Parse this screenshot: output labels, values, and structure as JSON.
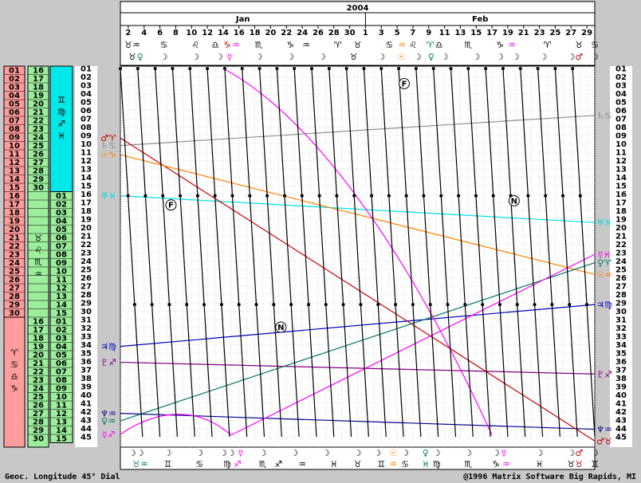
{
  "chart_data": {
    "type": "line",
    "title": "2004",
    "months": [
      {
        "name": "Jan",
        "start_day": 1,
        "end_day": 31
      },
      {
        "name": "Feb",
        "start_day": 32,
        "end_day": 60
      }
    ],
    "xlim": [
      1,
      61
    ],
    "ylim": [
      1,
      45
    ],
    "x_ticks": [
      {
        "day": 2,
        "label": "2"
      },
      {
        "day": 4,
        "label": "4"
      },
      {
        "day": 6,
        "label": "6"
      },
      {
        "day": 8,
        "label": "8"
      },
      {
        "day": 10,
        "label": "10"
      },
      {
        "day": 12,
        "label": "12"
      },
      {
        "day": 14,
        "label": "14"
      },
      {
        "day": 16,
        "label": "16"
      },
      {
        "day": 18,
        "label": "18"
      },
      {
        "day": 20,
        "label": "20"
      },
      {
        "day": 22,
        "label": "22"
      },
      {
        "day": 24,
        "label": "24"
      },
      {
        "day": 26,
        "label": "26"
      },
      {
        "day": 28,
        "label": "28"
      },
      {
        "day": 30,
        "label": "30"
      },
      {
        "day": 32,
        "label": "1"
      },
      {
        "day": 34,
        "label": "3"
      },
      {
        "day": 36,
        "label": "5"
      },
      {
        "day": 38,
        "label": "7"
      },
      {
        "day": 40,
        "label": "9"
      },
      {
        "day": 42,
        "label": "11"
      },
      {
        "day": 44,
        "label": "13"
      },
      {
        "day": 46,
        "label": "15"
      },
      {
        "day": 48,
        "label": "17"
      },
      {
        "day": 50,
        "label": "19"
      },
      {
        "day": 52,
        "label": "21"
      },
      {
        "day": 54,
        "label": "23"
      },
      {
        "day": 56,
        "label": "25"
      },
      {
        "day": 58,
        "label": "27"
      },
      {
        "day": 60,
        "label": "29"
      }
    ],
    "y_ticks": [
      "01",
      "02",
      "03",
      "04",
      "05",
      "06",
      "07",
      "08",
      "09",
      "10",
      "11",
      "12",
      "13",
      "14",
      "15",
      "16",
      "17",
      "18",
      "19",
      "20",
      "21",
      "22",
      "23",
      "24",
      "25",
      "26",
      "27",
      "28",
      "29",
      "30",
      "31",
      "32",
      "33",
      "34",
      "35",
      "36",
      "37",
      "38",
      "39",
      "40",
      "41",
      "42",
      "43",
      "44",
      "45"
    ],
    "sign_columns": [
      {
        "color": "#ff9c9c",
        "cells": [
          "01",
          "02",
          "03",
          "04",
          "05",
          "06",
          "07",
          "08",
          "09",
          "10",
          "11",
          "12",
          "13",
          "14",
          "15",
          "16",
          "17",
          "18",
          "19",
          "20",
          "21",
          "22",
          "23",
          "24",
          "25",
          "26",
          "27",
          "28",
          "29",
          "30"
        ],
        "bar_symbols": []
      },
      {
        "color": "#9cee9c",
        "cells": [
          "16",
          "17",
          "18",
          "19",
          "20",
          "21",
          "22",
          "23",
          "24",
          "25",
          "26",
          "27",
          "28",
          "29",
          "30",
          "01",
          "02",
          "03",
          "04",
          "05",
          "06",
          "07",
          "08",
          "09",
          "10",
          "11",
          "12",
          "13",
          "14",
          "15"
        ],
        "bar_symbols": []
      },
      {
        "color": "#00e8e8",
        "cells": [
          "01",
          "02",
          "03",
          "04",
          "05",
          "06",
          "07",
          "08",
          "09",
          "10",
          "11",
          "12",
          "13",
          "14",
          "15"
        ],
        "bar_symbols": [
          "♊",
          "♍",
          "♐",
          "♓"
        ]
      },
      {
        "color": "#9cee9c",
        "cells": [
          "01",
          "02",
          "03",
          "04",
          "05",
          "06",
          "07",
          "08",
          "09",
          "10",
          "11",
          "12",
          "13",
          "14",
          "15"
        ],
        "bar_symbols": []
      },
      {
        "color": "#9cee9c",
        "cells": [
          "01",
          "02",
          "03",
          "04",
          "05",
          "06",
          "07",
          "08",
          "09",
          "10",
          "11",
          "12",
          "13",
          "14",
          "15"
        ],
        "bar_symbols": []
      }
    ],
    "bar_symbol_sets": [
      {
        "symbols": [
          "♉",
          "♌",
          "♏",
          "♒"
        ],
        "color": "#9cee9c"
      },
      {
        "symbols": [
          "♈",
          "♋",
          "♎",
          "♑"
        ],
        "color": "#ff9c9c"
      }
    ],
    "planet_lines": [
      {
        "glyph": "♄♋",
        "color": "#909090",
        "start": [
          1,
          10.2
        ],
        "end": [
          61,
          6.6
        ],
        "label_left": "♄♋",
        "label_right": "♄♋"
      },
      {
        "glyph": "♅♓",
        "color": "#00e0e0",
        "start": [
          1,
          16.2
        ],
        "end": [
          61,
          19.4
        ],
        "label_left": "♅♓",
        "label_right": "♅♓"
      },
      {
        "glyph": "♃♍",
        "color": "#0000c0",
        "start": [
          1,
          34.2
        ],
        "end": [
          61,
          29.2
        ],
        "label_left": "♃♍",
        "label_right": "♃♍"
      },
      {
        "glyph": "♇♐",
        "color": "#800080",
        "start": [
          1,
          36.1
        ],
        "end": [
          61,
          37.5
        ],
        "label_left": "♇♐",
        "label_right": "♇♐"
      },
      {
        "glyph": "♆♒",
        "color": "#000090",
        "start": [
          1,
          42.2
        ],
        "end": [
          61,
          44.1
        ],
        "label_left": "♆♒",
        "label_right": "♆♒"
      },
      {
        "glyph": "♂♈",
        "color": "#c00000",
        "start": [
          1,
          9.3
        ],
        "end": [
          61,
          45.5
        ],
        "label_left": "♂♈",
        "label_right": "♂♉"
      },
      {
        "glyph": "☉♑",
        "color": "#ff8000",
        "start": [
          1,
          11.3
        ],
        "end": [
          61,
          25.6
        ],
        "label_left": "☉♑",
        "label_right": "☉♒"
      },
      {
        "glyph": "♀♒",
        "color": "#007860",
        "start": [
          1,
          43.1
        ],
        "end": [
          61,
          24.2
        ],
        "label_left": "♀♒",
        "label_right": "♀♈"
      },
      {
        "glyph": "☿♐",
        "color": "#ff00ff",
        "start": [
          1,
          44.7
        ],
        "end": [
          61,
          23.2
        ],
        "label_left": "☿♐",
        "label_right": "☿♓"
      }
    ],
    "moon_line_start_days": [
      1.0,
      3.2,
      5.4,
      7.6,
      9.8,
      12.0,
      14.2,
      16.4,
      18.6,
      20.8,
      23.0,
      25.2,
      27.4,
      29.6,
      31.8,
      34.0,
      36.2,
      38.4,
      40.6,
      42.8,
      45.0,
      47.2,
      49.4,
      51.6,
      53.8,
      56.0,
      58.2,
      60.4
    ],
    "moon_line_end_days": [
      3.8,
      6.0,
      8.2,
      10.4,
      12.6,
      14.8,
      17.0,
      19.2,
      21.4,
      23.6,
      25.8,
      28.0,
      30.2,
      32.4,
      34.6,
      36.8,
      39.0,
      41.2,
      43.4,
      45.6,
      47.8,
      50.0,
      52.2,
      54.4,
      56.6,
      58.8,
      61.0
    ],
    "markers": [
      {
        "day": 36.9,
        "value": 2.8,
        "label": "F"
      },
      {
        "day": 7.4,
        "value": 17.3,
        "label": "F"
      },
      {
        "day": 50.8,
        "value": 16.8,
        "label": "N"
      },
      {
        "day": 21.3,
        "value": 31.9,
        "label": "N"
      }
    ],
    "top_glyph_row1": [
      {
        "day": 2.5,
        "text": "♉♒",
        "color": "#000000"
      },
      {
        "day": 6.5,
        "text": "♋",
        "color": "#000000"
      },
      {
        "day": 10.5,
        "text": "♌",
        "color": "#000000"
      },
      {
        "day": 13.0,
        "text": "♎",
        "color": "#000000"
      },
      {
        "day": 14.5,
        "text": "♑",
        "color": "#c00000"
      },
      {
        "day": 15.6,
        "text": "♒",
        "color": "#ff00ff"
      },
      {
        "day": 18.5,
        "text": "♏",
        "color": "#000000"
      },
      {
        "day": 22.5,
        "text": "♑",
        "color": "#000000"
      },
      {
        "day": 24.5,
        "text": "♒",
        "color": "#000000"
      },
      {
        "day": 28.5,
        "text": "♈",
        "color": "#000000"
      },
      {
        "day": 31.0,
        "text": "♉",
        "color": "#000000"
      },
      {
        "day": 35.0,
        "text": "♋",
        "color": "#000000"
      },
      {
        "day": 36.6,
        "text": "♒",
        "color": "#ff8000"
      },
      {
        "day": 38.0,
        "text": "♌",
        "color": "#000000"
      },
      {
        "day": 40.2,
        "text": "♈",
        "color": "#007860"
      },
      {
        "day": 41.3,
        "text": "♎",
        "color": "#000000"
      },
      {
        "day": 45.0,
        "text": "♏",
        "color": "#000000"
      },
      {
        "day": 49.0,
        "text": "♑",
        "color": "#000000"
      },
      {
        "day": 50.5,
        "text": "♒",
        "color": "#ff00ff"
      },
      {
        "day": 55.0,
        "text": "♈",
        "color": "#000000"
      },
      {
        "day": 59.0,
        "text": "♉",
        "color": "#000000"
      },
      {
        "day": 61.0,
        "text": "♋",
        "color": "#000000"
      }
    ],
    "top_glyph_row2": [
      {
        "day": 2.5,
        "text": "♉",
        "color": "#000000"
      },
      {
        "day": 3.5,
        "text": "♀",
        "color": "#007860"
      },
      {
        "day": 6.5,
        "text": "☽",
        "color": "#000000"
      },
      {
        "day": 10.5,
        "text": "☽",
        "color": "#000000"
      },
      {
        "day": 13.5,
        "text": "☽",
        "color": "#000000"
      },
      {
        "day": 14.8,
        "text": "☿",
        "color": "#ff00ff"
      },
      {
        "day": 18.5,
        "text": "☽",
        "color": "#000000"
      },
      {
        "day": 22.5,
        "text": "☽",
        "color": "#000000"
      },
      {
        "day": 26.5,
        "text": "☽",
        "color": "#000000"
      },
      {
        "day": 30.5,
        "text": "♉",
        "color": "#000000"
      },
      {
        "day": 34.0,
        "text": "☽",
        "color": "#000000"
      },
      {
        "day": 36.5,
        "text": "☉",
        "color": "#ff8000"
      },
      {
        "day": 38.6,
        "text": "☽",
        "color": "#000000"
      },
      {
        "day": 40.3,
        "text": "♀",
        "color": "#007860"
      },
      {
        "day": 42.0,
        "text": "☽",
        "color": "#000000"
      },
      {
        "day": 46.0,
        "text": "☽",
        "color": "#000000"
      },
      {
        "day": 49.0,
        "text": "☽",
        "color": "#000000"
      },
      {
        "day": 51.0,
        "text": "☽",
        "color": "#000000"
      },
      {
        "day": 54.5,
        "text": "☽",
        "color": "#000000"
      },
      {
        "day": 58.0,
        "text": "☽",
        "color": "#000000"
      },
      {
        "day": 59.0,
        "text": "♂",
        "color": "#c00000"
      },
      {
        "day": 61.0,
        "text": "☽",
        "color": "#000000"
      }
    ],
    "bottom_glyph_row1": [
      {
        "day": 2.5,
        "text": "☽",
        "color": "#000000"
      },
      {
        "day": 3.5,
        "text": "☽",
        "color": "#000000"
      },
      {
        "day": 7.0,
        "text": "☽",
        "color": "#000000"
      },
      {
        "day": 11.0,
        "text": "☽",
        "color": "#000000"
      },
      {
        "day": 14.0,
        "text": "☽",
        "color": "#000000"
      },
      {
        "day": 15.0,
        "text": "☽",
        "color": "#000000"
      },
      {
        "day": 16.2,
        "text": "☿",
        "color": "#ff00ff"
      },
      {
        "day": 19.0,
        "text": "☽",
        "color": "#000000"
      },
      {
        "day": 23.0,
        "text": "☽",
        "color": "#000000"
      },
      {
        "day": 27.0,
        "text": "☽",
        "color": "#000000"
      },
      {
        "day": 31.0,
        "text": "☽",
        "color": "#000000"
      },
      {
        "day": 33.5,
        "text": "☽",
        "color": "#000000"
      },
      {
        "day": 35.5,
        "text": "☉",
        "color": "#ff8000"
      },
      {
        "day": 37.0,
        "text": "☽",
        "color": "#000000"
      },
      {
        "day": 39.6,
        "text": "♀",
        "color": "#007860"
      },
      {
        "day": 41.0,
        "text": "☽",
        "color": "#000000"
      },
      {
        "day": 45.0,
        "text": "☽",
        "color": "#000000"
      },
      {
        "day": 48.5,
        "text": "☽",
        "color": "#000000"
      },
      {
        "day": 49.5,
        "text": "☿",
        "color": "#ff00ff"
      },
      {
        "day": 54.0,
        "text": "☽",
        "color": "#000000"
      },
      {
        "day": 58.0,
        "text": "☽",
        "color": "#000000"
      },
      {
        "day": 59.0,
        "text": "♂",
        "color": "#c00000"
      },
      {
        "day": 61.0,
        "text": "☽",
        "color": "#000000"
      }
    ],
    "bottom_glyph_row2": [
      {
        "day": 3.5,
        "text": "♉♒",
        "color": "#007860"
      },
      {
        "day": 7.0,
        "text": "♊",
        "color": "#000000"
      },
      {
        "day": 11.0,
        "text": "♋",
        "color": "#000000"
      },
      {
        "day": 14.5,
        "text": "♍",
        "color": "#000000"
      },
      {
        "day": 15.8,
        "text": "♐",
        "color": "#ff00ff"
      },
      {
        "day": 19.0,
        "text": "♏",
        "color": "#000000"
      },
      {
        "day": 21.0,
        "text": "♐",
        "color": "#000000"
      },
      {
        "day": 24.0,
        "text": "♒",
        "color": "#000000"
      },
      {
        "day": 28.0,
        "text": "♓",
        "color": "#000000"
      },
      {
        "day": 31.0,
        "text": "♉",
        "color": "#000000"
      },
      {
        "day": 34.0,
        "text": "♊",
        "color": "#000000"
      },
      {
        "day": 35.5,
        "text": "♒",
        "color": "#ff8000"
      },
      {
        "day": 37.0,
        "text": "♋",
        "color": "#000000"
      },
      {
        "day": 39.6,
        "text": "♓",
        "color": "#007860"
      },
      {
        "day": 41.0,
        "text": "♍",
        "color": "#000000"
      },
      {
        "day": 45.0,
        "text": "♏",
        "color": "#000000"
      },
      {
        "day": 48.5,
        "text": "♑",
        "color": "#000000"
      },
      {
        "day": 49.8,
        "text": "♒",
        "color": "#ff00ff"
      },
      {
        "day": 54.0,
        "text": "♓",
        "color": "#000000"
      },
      {
        "day": 58.0,
        "text": "♉",
        "color": "#000000"
      },
      {
        "day": 59.0,
        "text": "♉",
        "color": "#c00000"
      },
      {
        "day": 61.0,
        "text": "♊",
        "color": "#000000"
      }
    ],
    "footer": {
      "left": "Geoc.  Longitude   45° Dial",
      "right": "@1996 Matrix Software   Big Rapids, MI"
    }
  }
}
